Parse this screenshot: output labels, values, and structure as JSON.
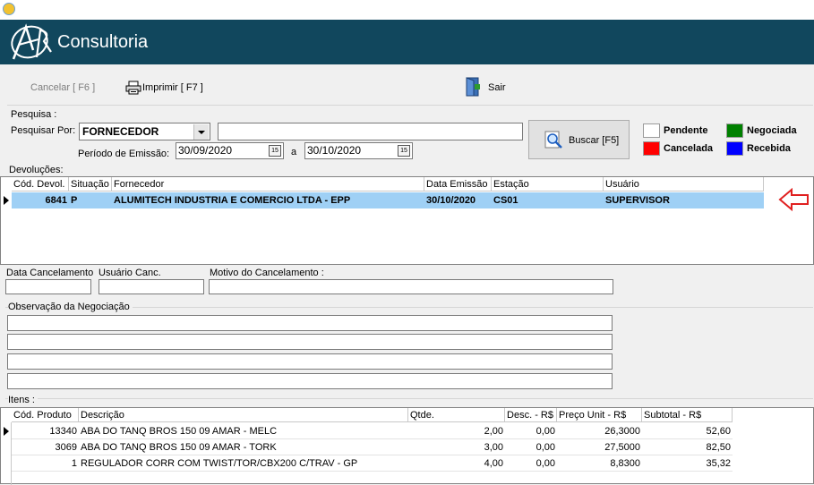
{
  "brand": {
    "name": "Consultoria"
  },
  "toolbar": {
    "cancel_label": "Cancelar [ F6 ]",
    "print_label": "Imprimir [ F7 ]",
    "exit_label": "Sair"
  },
  "search": {
    "section_label": "Pesquisa :",
    "search_by_label": "Pesquisar Por:",
    "search_by_value": "FORNECEDOR",
    "search_text": "",
    "period_label": "Período de Emissão:",
    "date_from": "30/09/2020",
    "date_separator": "a",
    "date_to": "30/10/2020",
    "search_button_label": "Buscar [F5]"
  },
  "legend": {
    "items": [
      {
        "label": "Pendente",
        "color": "#ffffff"
      },
      {
        "label": "Negociada",
        "color": "#008000"
      },
      {
        "label": "Cancelada",
        "color": "#ff0000"
      },
      {
        "label": "Recebida",
        "color": "#0000ff"
      }
    ]
  },
  "devolucoes": {
    "section_label": "Devoluções:",
    "columns": [
      "Cód. Devol.",
      "Situação",
      "Fornecedor",
      "Data Emissão",
      "Estação",
      "Usuário"
    ],
    "rows": [
      {
        "cod": "6841",
        "situacao": "P",
        "fornecedor": "ALUMITECH INDUSTRIA E COMERCIO LTDA - EPP",
        "data": "30/10/2020",
        "estacao": "CS01",
        "usuario": "SUPERVISOR"
      }
    ],
    "selected_color": "#9fd0f5",
    "indicator_color": "#e02020"
  },
  "cancel_fields": {
    "data_label": "Data Cancelamento",
    "usuario_label": "Usuário Canc.",
    "motivo_label": "Motivo do Cancelamento  :"
  },
  "observacao": {
    "label": "Observação da Negociação"
  },
  "itens": {
    "section_label": "Itens :",
    "columns": [
      "Cód. Produto",
      "Descrição",
      "Qtde.",
      "Desc. - R$",
      "Preço Unit - R$",
      "Subtotal - R$"
    ],
    "rows": [
      {
        "cod": "13340",
        "descricao": "ABA DO TANQ BROS 150 09 AMAR - MELC",
        "qtde": "2,00",
        "desc": "0,00",
        "preco": "26,3000",
        "subtotal": "52,60"
      },
      {
        "cod": "3069",
        "descricao": "ABA DO TANQ BROS 150 09 AMAR - TORK",
        "qtde": "3,00",
        "desc": "0,00",
        "preco": "27,5000",
        "subtotal": "82,50"
      },
      {
        "cod": "1",
        "descricao": "REGULADOR CORR COM TWIST/TOR/CBX200 C/TRAV - GP",
        "qtde": "4,00",
        "desc": "0,00",
        "preco": "8,8300",
        "subtotal": "35,32"
      }
    ]
  },
  "colors": {
    "banner": "#11475d"
  }
}
